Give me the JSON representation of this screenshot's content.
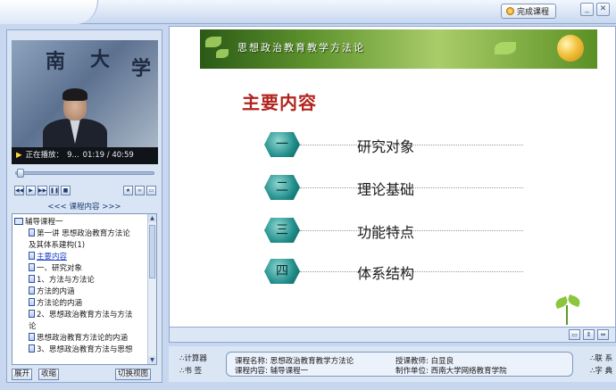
{
  "topbar": {
    "finish_label": "完成课程",
    "minimize": "_",
    "close": "✕"
  },
  "video": {
    "wall_chars": [
      "南",
      "大",
      "学"
    ],
    "status_prefix": "正在播放：",
    "status_text": "9...",
    "time": "01:19 / 40:59"
  },
  "player": {
    "progress_fraction": 0.02
  },
  "course": {
    "heading": "<<< 课程内容 >>>",
    "tree": [
      {
        "label": "辅导课程一",
        "kind": "book"
      },
      {
        "label": "第一讲  思想政治教育方法论",
        "kind": "doc"
      },
      {
        "label": "及其体系建构(1)",
        "kind": "cont"
      },
      {
        "label": "主要内容",
        "kind": "doc",
        "selected": true
      },
      {
        "label": "一、研究对象",
        "kind": "doc"
      },
      {
        "label": "1、方法与方法论",
        "kind": "doc"
      },
      {
        "label": "方法的内涵",
        "kind": "doc"
      },
      {
        "label": "方法论的内涵",
        "kind": "doc"
      },
      {
        "label": "2、思想政治教育方法与方法",
        "kind": "doc"
      },
      {
        "label": "论",
        "kind": "cont"
      },
      {
        "label": "思想政治教育方法论的内涵",
        "kind": "doc"
      },
      {
        "label": "3、思想政治教育方法与思想",
        "kind": "doc"
      }
    ],
    "expand_label": "展开",
    "collapse_label": "收缩",
    "switch_view_label": "切换视图"
  },
  "slide": {
    "banner_title": "思想政治教育教学方法论",
    "main_title": "主要内容",
    "items": [
      {
        "num": "一",
        "label": "研究对象"
      },
      {
        "num": "二",
        "label": "理论基础"
      },
      {
        "num": "三",
        "label": "功能特点"
      },
      {
        "num": "四",
        "label": "体系结构"
      }
    ]
  },
  "info": {
    "calculator": "计算器",
    "bookmark": "书  签",
    "course_name": "课程名称: 思想政治教育教学方法论",
    "course_content": "课程内容: 辅导课程一",
    "teacher": "授课教师: 白显良",
    "unit": "制作单位: 西南大学网络教育学院",
    "right1": "联 系",
    "right2": "字 典"
  }
}
